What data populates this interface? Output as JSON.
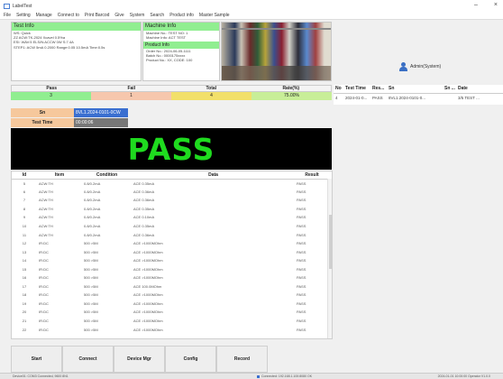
{
  "window": {
    "title": "LabelTest",
    "controls": [
      "–",
      "×"
    ]
  },
  "menu": [
    "File",
    "Setting",
    "Manage",
    "Connect to",
    "Print Barcod",
    "Give",
    "System",
    "Search",
    "Product info",
    "Master Sample"
  ],
  "test_info": {
    "header": "Test Info",
    "lines": [
      "WS: Quick",
      "ZZ ACW:TK-2024 Xcavel 0.5%a",
      "ESI: WAV:5 ELS/N:ACCW 0W S:7.4A",
      "STEP1: ACW 5mA 0.2000 Range:0.05 10.5mA Time:0.5s"
    ]
  },
  "machine_info": {
    "header": "Machine Info",
    "lines": [
      "Machine No.: TEST NO: 1",
      "Machine Info: ACT TEST"
    ],
    "product_header": "Product Info",
    "product_lines": [
      "Order No.: 2024-06-05-1111",
      "Batch No.: 0000175xxxx",
      "Product No.: XX, CODE: 100"
    ]
  },
  "user": {
    "label": "Admin(System)"
  },
  "summary": {
    "headers": [
      "Pass",
      "Fail",
      "Total",
      "Rate(%)"
    ],
    "values": [
      "3",
      "1",
      "4",
      "75.00%"
    ]
  },
  "sn": {
    "label": "Sn",
    "value": "8VL1.2024-0101-0CW"
  },
  "test_time": {
    "label": "Test Time",
    "value": "00:00:06"
  },
  "result": {
    "text": "PASS"
  },
  "items_table": {
    "headers": [
      "Id",
      "Item",
      "Condition",
      "Data",
      "Result"
    ],
    "rows": [
      [
        "5",
        "ACW:TH",
        "0.8/0.2mA",
        "ACE 0.35mA",
        "PASS"
      ],
      [
        "6",
        "ACW:TH",
        "0.8/0.2mA",
        "ACE 0.36mA",
        "PASS"
      ],
      [
        "7",
        "ACW:TH",
        "0.8/0.2mA",
        "ACE 0.36mA",
        "PASS"
      ],
      [
        "8",
        "ACW:TH",
        "0.8/0.2mA",
        "ACE 0.35mA",
        "PASS"
      ],
      [
        "9",
        "ACW:TH",
        "0.8/0.2mA",
        "ACE 0.10mA",
        "PASS"
      ],
      [
        "10",
        "ACW:TH",
        "0.8/0.2mA",
        "ACE 0.35mA",
        "PASS"
      ],
      [
        "11",
        "ACW:TH",
        "0.8/0.2mA",
        "ACE 0.36mA",
        "PASS"
      ],
      [
        "12",
        "IR:DC",
        "500 >5M",
        "ACE >1000MOhm",
        "PASS"
      ],
      [
        "13",
        "IR:DC",
        "500 >5M",
        "ACE >1000MOhm",
        "PASS"
      ],
      [
        "14",
        "IR:DC",
        "500 >5M",
        "ACE >1000MOhm",
        "PASS"
      ],
      [
        "15",
        "IR:DC",
        "500 >5M",
        "ACE >1000MOhm",
        "PASS"
      ],
      [
        "16",
        "IR:DC",
        "500 >5M",
        "ACE >1000MOhm",
        "PASS"
      ],
      [
        "17",
        "IR:DC",
        "500 >5M",
        "ACE 100.0MOhm",
        "PASS"
      ],
      [
        "18",
        "IR:DC",
        "500 >5M",
        "ACE >1000MOhm",
        "PASS"
      ],
      [
        "19",
        "IR:DC",
        "500 >5M",
        "ACE >1000MOhm",
        "PASS"
      ],
      [
        "20",
        "IR:DC",
        "500 >5M",
        "ACE >1000MOhm",
        "PASS"
      ],
      [
        "21",
        "IR:DC",
        "500 >5M",
        "ACE >1000MOhm",
        "PASS"
      ],
      [
        "22",
        "IR:DC",
        "500 >5M",
        "ACE >1000MOhm",
        "PASS"
      ]
    ]
  },
  "history_table": {
    "headers": [
      "No",
      "Test Time",
      "Res...",
      "Sn",
      "Sn ...",
      "Date"
    ],
    "rows": [
      [
        "4",
        "2024-01-0...",
        "PASS",
        "8VL1.2024-0101-0...",
        "",
        "3/5 TEST ..."
      ]
    ]
  },
  "buttons": [
    "Start",
    "Connect",
    "Device Mgr",
    "Config",
    "Record"
  ],
  "status": {
    "left": "Device01: COM3 Connected, 9600 8N1",
    "middle": "Connected: 192.168.1.100:8080 OK",
    "right": "2024-01-01 10:00:00   Operator   V1.0.0"
  }
}
